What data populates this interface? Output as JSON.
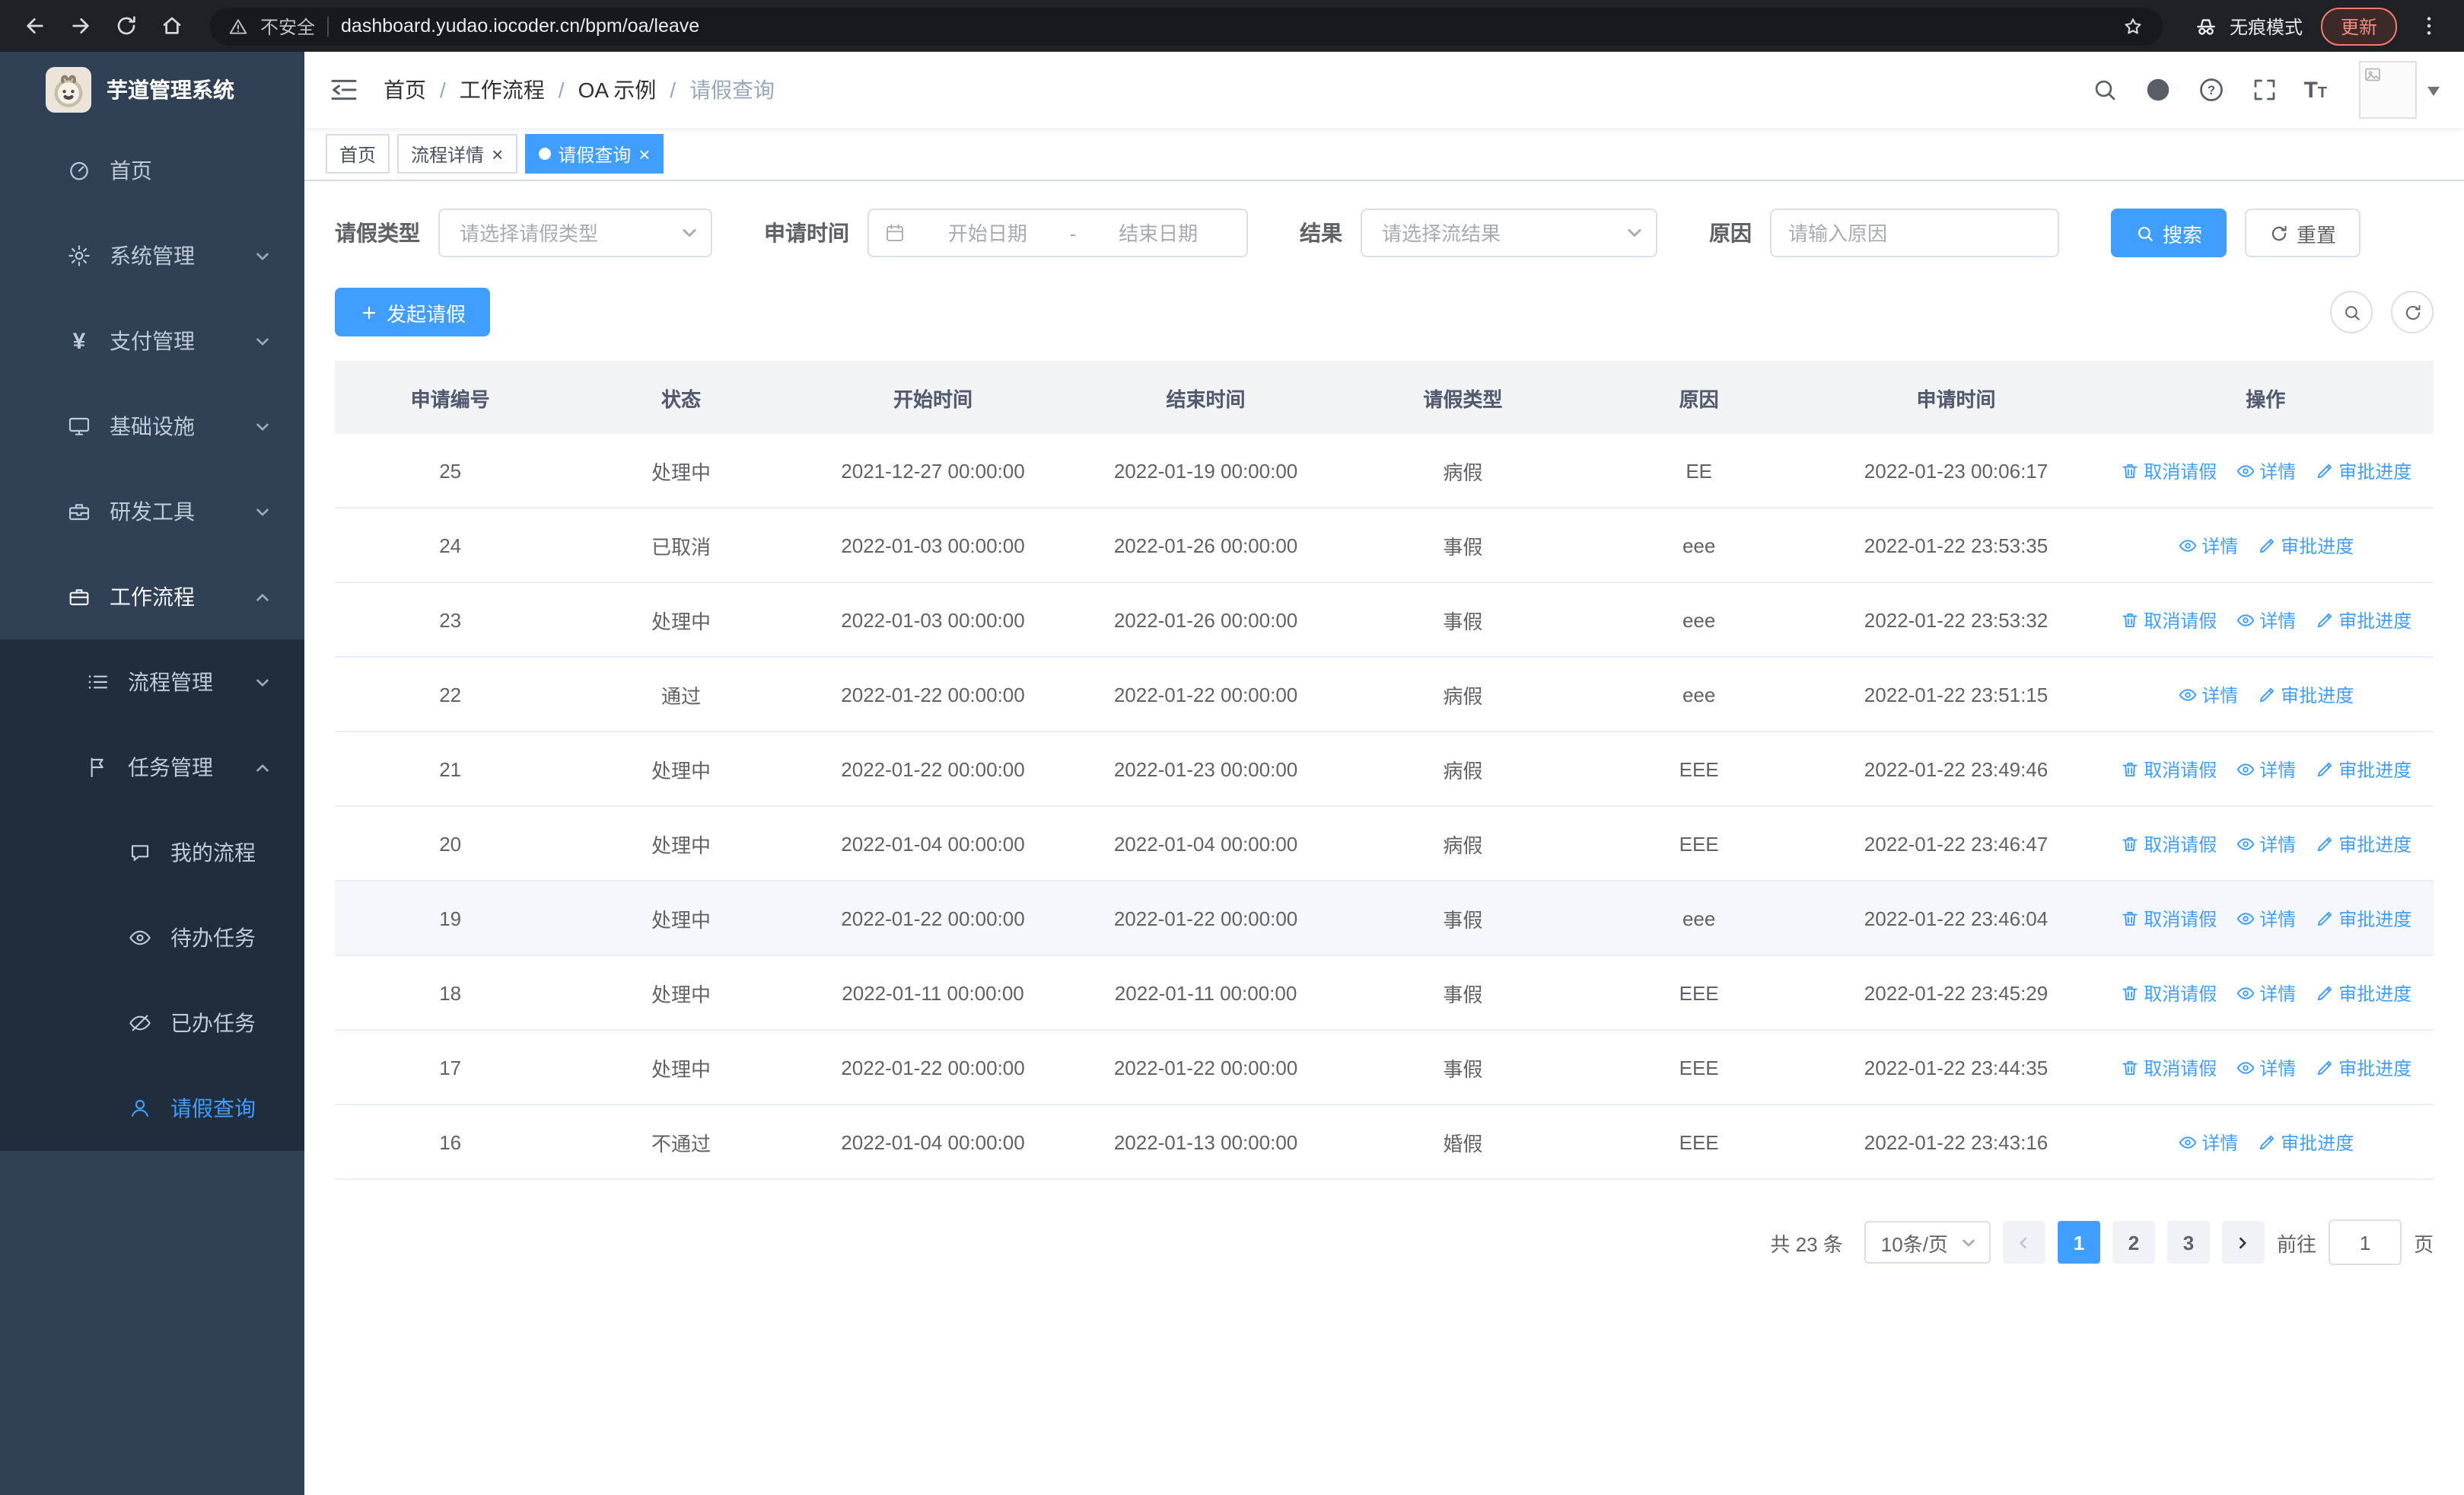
{
  "browser": {
    "security_label": "不安全",
    "url": "dashboard.yudao.iocoder.cn/bpm/oa/leave",
    "incognito_label": "无痕模式",
    "update_label": "更新"
  },
  "sidebar": {
    "title": "芋道管理系统",
    "menu": [
      {
        "label": "首页"
      },
      {
        "label": "系统管理"
      },
      {
        "label": "支付管理"
      },
      {
        "label": "基础设施"
      },
      {
        "label": "研发工具"
      },
      {
        "label": "工作流程"
      }
    ],
    "submenu": [
      {
        "label": "流程管理"
      },
      {
        "label": "任务管理"
      }
    ],
    "tasks": [
      {
        "label": "我的流程"
      },
      {
        "label": "待办任务"
      },
      {
        "label": "已办任务"
      },
      {
        "label": "请假查询"
      }
    ]
  },
  "navbar": {
    "separator": "/",
    "breadcrumb": [
      {
        "label": "首页"
      },
      {
        "label": "工作流程"
      },
      {
        "label": "OA 示例"
      },
      {
        "label": "请假查询"
      }
    ]
  },
  "tabs": [
    {
      "label": "首页"
    },
    {
      "label": "流程详情"
    },
    {
      "label": "请假查询"
    }
  ],
  "filters": {
    "leave_type_label": "请假类型",
    "leave_type_placeholder": "请选择请假类型",
    "apply_time_label": "申请时间",
    "start_date_placeholder": "开始日期",
    "range_separator": "-",
    "end_date_placeholder": "结束日期",
    "result_label": "结果",
    "result_placeholder": "请选择流结果",
    "reason_label": "原因",
    "reason_placeholder": "请输入原因",
    "search_label": "搜索",
    "reset_label": "重置"
  },
  "toolbar": {
    "create_label": "发起请假"
  },
  "table": {
    "columns": [
      "申请编号",
      "状态",
      "开始时间",
      "结束时间",
      "请假类型",
      "原因",
      "申请时间",
      "操作"
    ],
    "action_labels": {
      "cancel": "取消请假",
      "detail": "详情",
      "progress": "审批进度"
    },
    "rows": [
      {
        "id": "25",
        "status": "处理中",
        "start": "2021-12-27 00:00:00",
        "end": "2022-01-19 00:00:00",
        "type": "病假",
        "reason": "EE",
        "applied": "2022-01-23 00:06:17",
        "actions": [
          "cancel",
          "detail",
          "progress"
        ],
        "highlight": false
      },
      {
        "id": "24",
        "status": "已取消",
        "start": "2022-01-03 00:00:00",
        "end": "2022-01-26 00:00:00",
        "type": "事假",
        "reason": "eee",
        "applied": "2022-01-22 23:53:35",
        "actions": [
          "detail",
          "progress"
        ],
        "highlight": false
      },
      {
        "id": "23",
        "status": "处理中",
        "start": "2022-01-03 00:00:00",
        "end": "2022-01-26 00:00:00",
        "type": "事假",
        "reason": "eee",
        "applied": "2022-01-22 23:53:32",
        "actions": [
          "cancel",
          "detail",
          "progress"
        ],
        "highlight": false
      },
      {
        "id": "22",
        "status": "通过",
        "start": "2022-01-22 00:00:00",
        "end": "2022-01-22 00:00:00",
        "type": "病假",
        "reason": "eee",
        "applied": "2022-01-22 23:51:15",
        "actions": [
          "detail",
          "progress"
        ],
        "highlight": false
      },
      {
        "id": "21",
        "status": "处理中",
        "start": "2022-01-22 00:00:00",
        "end": "2022-01-23 00:00:00",
        "type": "病假",
        "reason": "EEE",
        "applied": "2022-01-22 23:49:46",
        "actions": [
          "cancel",
          "detail",
          "progress"
        ],
        "highlight": false
      },
      {
        "id": "20",
        "status": "处理中",
        "start": "2022-01-04 00:00:00",
        "end": "2022-01-04 00:00:00",
        "type": "病假",
        "reason": "EEE",
        "applied": "2022-01-22 23:46:47",
        "actions": [
          "cancel",
          "detail",
          "progress"
        ],
        "highlight": false
      },
      {
        "id": "19",
        "status": "处理中",
        "start": "2022-01-22 00:00:00",
        "end": "2022-01-22 00:00:00",
        "type": "事假",
        "reason": "eee",
        "applied": "2022-01-22 23:46:04",
        "actions": [
          "cancel",
          "detail",
          "progress"
        ],
        "highlight": true
      },
      {
        "id": "18",
        "status": "处理中",
        "start": "2022-01-11 00:00:00",
        "end": "2022-01-11 00:00:00",
        "type": "事假",
        "reason": "EEE",
        "applied": "2022-01-22 23:45:29",
        "actions": [
          "cancel",
          "detail",
          "progress"
        ],
        "highlight": false
      },
      {
        "id": "17",
        "status": "处理中",
        "start": "2022-01-22 00:00:00",
        "end": "2022-01-22 00:00:00",
        "type": "事假",
        "reason": "EEE",
        "applied": "2022-01-22 23:44:35",
        "actions": [
          "cancel",
          "detail",
          "progress"
        ],
        "highlight": false
      },
      {
        "id": "16",
        "status": "不通过",
        "start": "2022-01-04 00:00:00",
        "end": "2022-01-13 00:00:00",
        "type": "婚假",
        "reason": "EEE",
        "applied": "2022-01-22 23:43:16",
        "actions": [
          "detail",
          "progress"
        ],
        "highlight": false
      }
    ]
  },
  "pagination": {
    "total_label": "共 23 条",
    "page_size": "10条/页",
    "pages": [
      "1",
      "2",
      "3"
    ],
    "active_page": "1",
    "goto_label": "前往",
    "goto_value": "1",
    "unit_label": "页"
  },
  "theme": {
    "primary": "#409eff",
    "sidebar_bg": "#304156",
    "sidebar_submenu_bg": "#1f2d3d"
  }
}
